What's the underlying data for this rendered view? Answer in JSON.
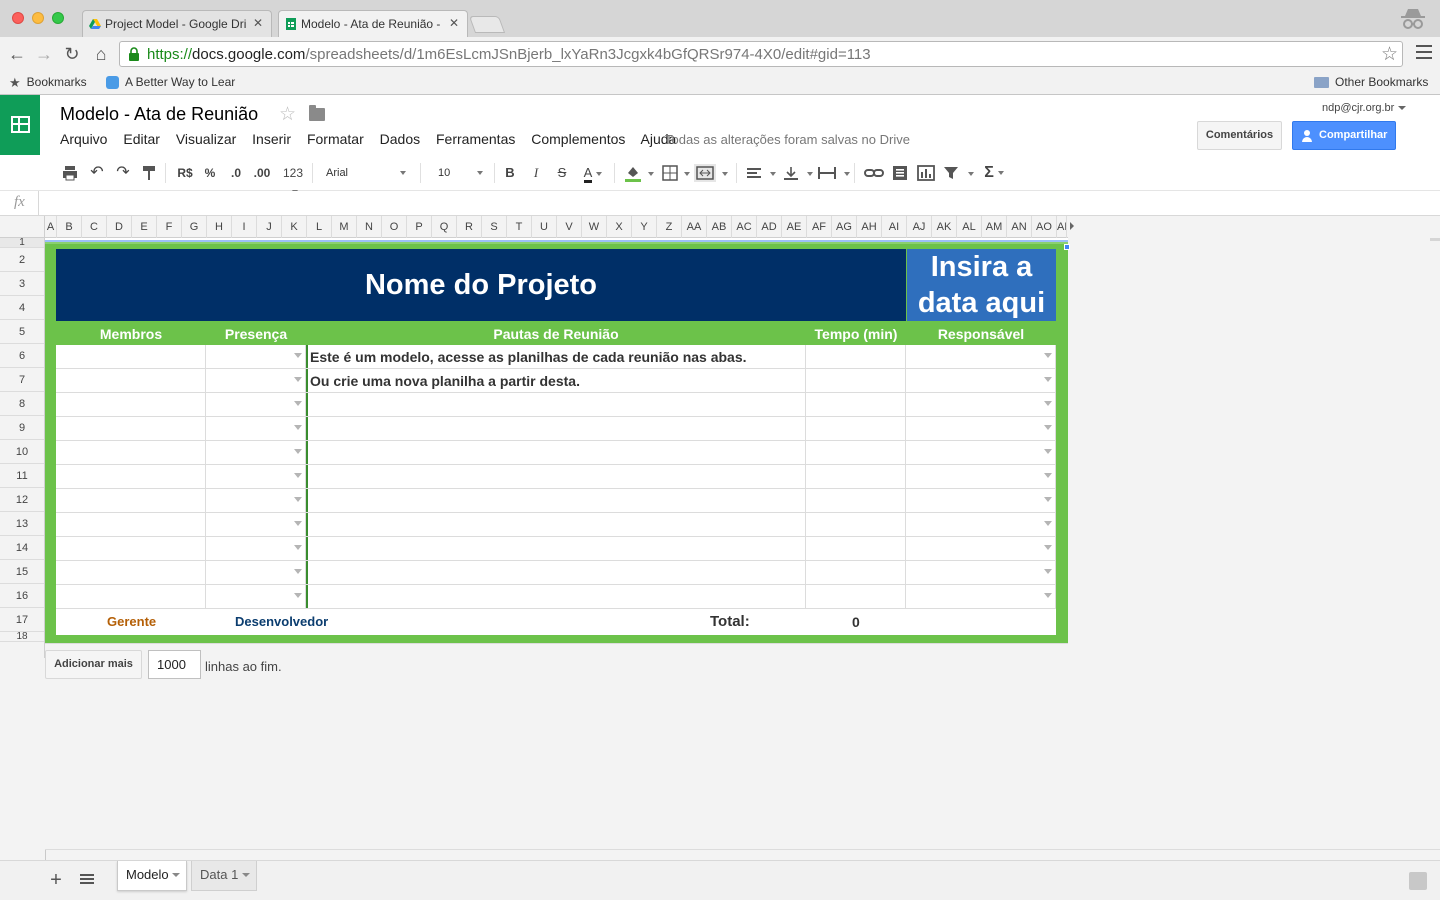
{
  "browser": {
    "tabs": [
      {
        "label": "Project Model - Google Dri",
        "active": false
      },
      {
        "label": "Modelo - Ata de Reunião - ",
        "active": true
      }
    ],
    "url": {
      "scheme": "https://",
      "host": "docs.google.com",
      "path": "/spreadsheets/d/1m6EsLcmJSnBjerb_lxYaRn3Jcgxk4bGfQRSr974-4X0/edit#gid=113"
    },
    "bookmarks": {
      "bookmarks_label": "Bookmarks",
      "item1": "A Better Way to Lear",
      "other": "Other Bookmarks"
    }
  },
  "header": {
    "title": "Modelo - Ata de Reunião",
    "account": "ndp@cjr.org.br",
    "menu": [
      "Arquivo",
      "Editar",
      "Visualizar",
      "Inserir",
      "Formatar",
      "Dados",
      "Ferramentas",
      "Complementos",
      "Ajuda"
    ],
    "status": "Todas as alterações foram salvas no Drive",
    "comments_label": "Comentários",
    "share_label": "Compartilhar"
  },
  "toolbar": {
    "currency": "R$",
    "percent": "%",
    "dec_less": ".0",
    "dec_more": ".00",
    "format_more": "123",
    "font": "Arial",
    "font_size": "10",
    "bold": "B",
    "italic": "I",
    "strike": "S",
    "text_color": "A",
    "sigma": "Σ"
  },
  "formula_bar": {
    "fx": "fx",
    "value": ""
  },
  "grid": {
    "columns": [
      "A",
      "B",
      "C",
      "D",
      "E",
      "F",
      "G",
      "H",
      "I",
      "J",
      "K",
      "L",
      "M",
      "N",
      "O",
      "P",
      "Q",
      "R",
      "S",
      "T",
      "U",
      "V",
      "W",
      "X",
      "Y",
      "Z",
      "AA",
      "AB",
      "AC",
      "AD",
      "AE",
      "AF",
      "AG",
      "AH",
      "AI",
      "AJ",
      "AK",
      "AL",
      "AM",
      "AN",
      "AO",
      "AP"
    ],
    "rows": [
      "1",
      "2",
      "3",
      "4",
      "5",
      "6",
      "7",
      "8",
      "9",
      "10",
      "11",
      "12",
      "13",
      "14",
      "15",
      "16",
      "17",
      "18"
    ]
  },
  "sheet": {
    "project_title": "Nome do Projeto",
    "date_placeholder_line1": "Insira a",
    "date_placeholder_line2": "data aqui",
    "headers": {
      "members": "Membros",
      "presence": "Presença",
      "agenda": "Pautas de Reunião",
      "time": "Tempo (min)",
      "owner": "Responsável"
    },
    "rows": [
      {
        "agenda": "Este é um modelo, acesse as planilhas de cada reunião nas abas."
      },
      {
        "agenda": "Ou crie uma nova planilha a partir desta."
      },
      {
        "agenda": ""
      },
      {
        "agenda": ""
      },
      {
        "agenda": ""
      },
      {
        "agenda": ""
      },
      {
        "agenda": ""
      },
      {
        "agenda": ""
      },
      {
        "agenda": ""
      },
      {
        "agenda": ""
      },
      {
        "agenda": ""
      }
    ],
    "footer": {
      "manager": "Gerente",
      "developer": "Desenvolvedor",
      "total_label": "Total:",
      "total_value": "0"
    },
    "colors": {
      "frame": "#6cc24a",
      "title_bg": "#002f67",
      "date_bg": "#2f6fbd",
      "manager": "#b45f06",
      "developer": "#0b3d6f"
    }
  },
  "add_rows": {
    "button": "Adicionar mais",
    "count": "1000",
    "suffix": "linhas ao fim."
  },
  "sheet_tabs": [
    {
      "label": "Modelo",
      "active": true
    },
    {
      "label": "Data 1",
      "active": false
    }
  ]
}
